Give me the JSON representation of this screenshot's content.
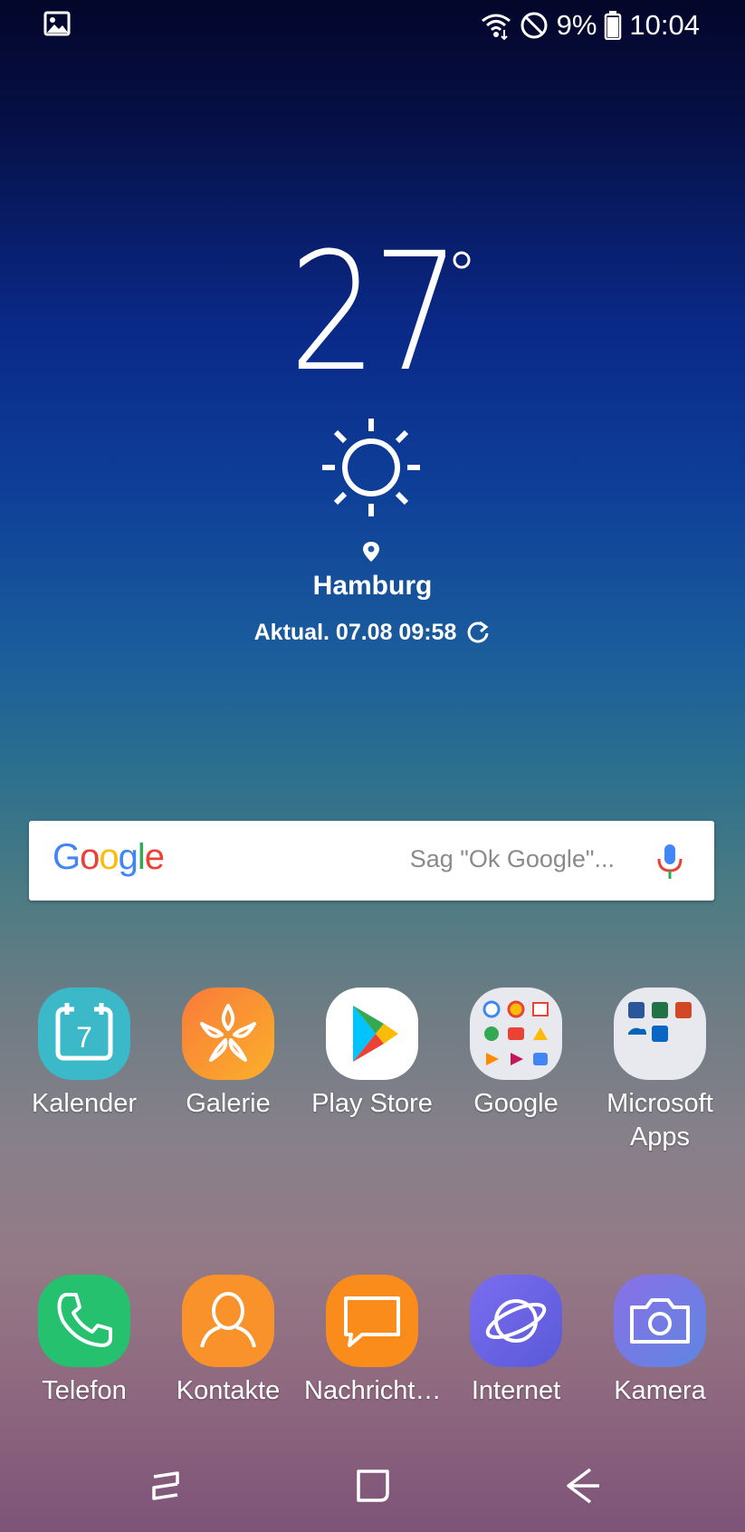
{
  "status_bar": {
    "battery_percent": "9%",
    "time": "10:04"
  },
  "weather": {
    "temperature": "27",
    "city": "Hamburg",
    "updated": "Aktual. 07.08 09:58"
  },
  "search": {
    "logo": "Google",
    "placeholder": "Sag \"Ok Google\"..."
  },
  "apps": [
    {
      "label": "Kalender",
      "icon": "calendar-icon",
      "color": "#3cb9c8"
    },
    {
      "label": "Galerie",
      "icon": "gallery-flower-icon",
      "color": "#f9952a"
    },
    {
      "label": "Play Store",
      "icon": "play-store-icon",
      "color": "#ffffff"
    },
    {
      "label": "Google",
      "icon": "folder-icon",
      "color": "#e7e9ee"
    },
    {
      "label": "Microsoft Apps",
      "icon": "folder-icon",
      "color": "#e7e9ee"
    }
  ],
  "calendar_day": "7",
  "dock": [
    {
      "label": "Telefon",
      "icon": "phone-icon",
      "color": "#25c16f"
    },
    {
      "label": "Kontakte",
      "icon": "contact-icon",
      "color": "#f9922a"
    },
    {
      "label": "Nachricht…",
      "icon": "message-icon",
      "color": "#f98c1a"
    },
    {
      "label": "Internet",
      "icon": "internet-planet-icon",
      "color": "#6e64e8"
    },
    {
      "label": "Kamera",
      "icon": "camera-icon",
      "color": "#6a78e0"
    }
  ]
}
